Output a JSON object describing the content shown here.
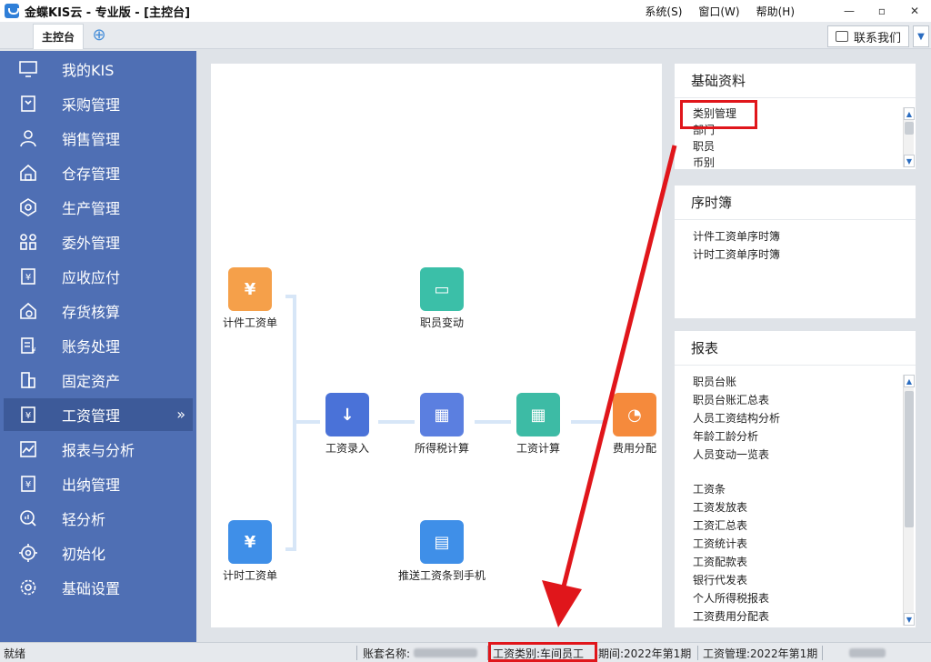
{
  "window": {
    "title": "金蝶KIS云 - 专业版 - [主控台]",
    "menu": [
      "系统(S)",
      "窗口(W)",
      "帮助(H)"
    ],
    "controls": [
      "—",
      "▫",
      "✕"
    ]
  },
  "tabs": {
    "active": "主控台",
    "contact_button": "联系我们"
  },
  "sidebar": {
    "items": [
      {
        "label": "我的KIS",
        "icon": "monitor-icon"
      },
      {
        "label": "采购管理",
        "icon": "purchase-icon"
      },
      {
        "label": "销售管理",
        "icon": "sales-icon"
      },
      {
        "label": "仓存管理",
        "icon": "warehouse-icon"
      },
      {
        "label": "生产管理",
        "icon": "production-icon"
      },
      {
        "label": "委外管理",
        "icon": "outsource-icon"
      },
      {
        "label": "应收应付",
        "icon": "receivable-icon"
      },
      {
        "label": "存货核算",
        "icon": "inventory-icon"
      },
      {
        "label": "账务处理",
        "icon": "accounting-icon"
      },
      {
        "label": "固定资产",
        "icon": "asset-icon"
      },
      {
        "label": "工资管理",
        "icon": "payroll-icon"
      },
      {
        "label": "报表与分析",
        "icon": "chart-icon"
      },
      {
        "label": "出纳管理",
        "icon": "cashier-icon"
      },
      {
        "label": "轻分析",
        "icon": "analysis-icon"
      },
      {
        "label": "初始化",
        "icon": "init-icon"
      },
      {
        "label": "基础设置",
        "icon": "settings-icon"
      }
    ],
    "active_index": 10
  },
  "flow": {
    "nodes": [
      {
        "label": "计件工资单",
        "color": "#f5a04a",
        "glyph": "¥"
      },
      {
        "label": "职员变动",
        "color": "#3bbfa8",
        "glyph": "▭"
      },
      {
        "label": "工资录入",
        "color": "#4a72d8",
        "glyph": "↓"
      },
      {
        "label": "所得税计算",
        "color": "#5b7fe0",
        "glyph": "▦"
      },
      {
        "label": "工资计算",
        "color": "#3dbba5",
        "glyph": "▦"
      },
      {
        "label": "费用分配",
        "color": "#f58a3c",
        "glyph": "◔"
      },
      {
        "label": "计时工资单",
        "color": "#3f8fe8",
        "glyph": "¥"
      },
      {
        "label": "推送工资条到手机",
        "color": "#3f8fe8",
        "glyph": "▤"
      }
    ]
  },
  "panels": {
    "basic": {
      "title": "基础资料",
      "items": [
        "类别管理",
        "部门",
        "职员",
        "币别"
      ]
    },
    "timesheet": {
      "title": "序时簿",
      "items": [
        "计件工资单序时簿",
        "计时工资单序时簿"
      ]
    },
    "reports": {
      "title": "报表",
      "items": [
        "职员台账",
        "职员台账汇总表",
        "人员工资结构分析",
        "年龄工龄分析",
        "人员变动一览表",
        "",
        "工资条",
        "工资发放表",
        "工资汇总表",
        "工资统计表",
        "工资配款表",
        "银行代发表",
        "个人所得税报表",
        "工资费用分配表"
      ]
    }
  },
  "status": {
    "ready": "就绪",
    "account_label": "账套名称:",
    "salary_category": "工资类别:车间员工",
    "period": "期间:2022年第1期",
    "payroll_period": "工资管理:2022年第1期"
  }
}
